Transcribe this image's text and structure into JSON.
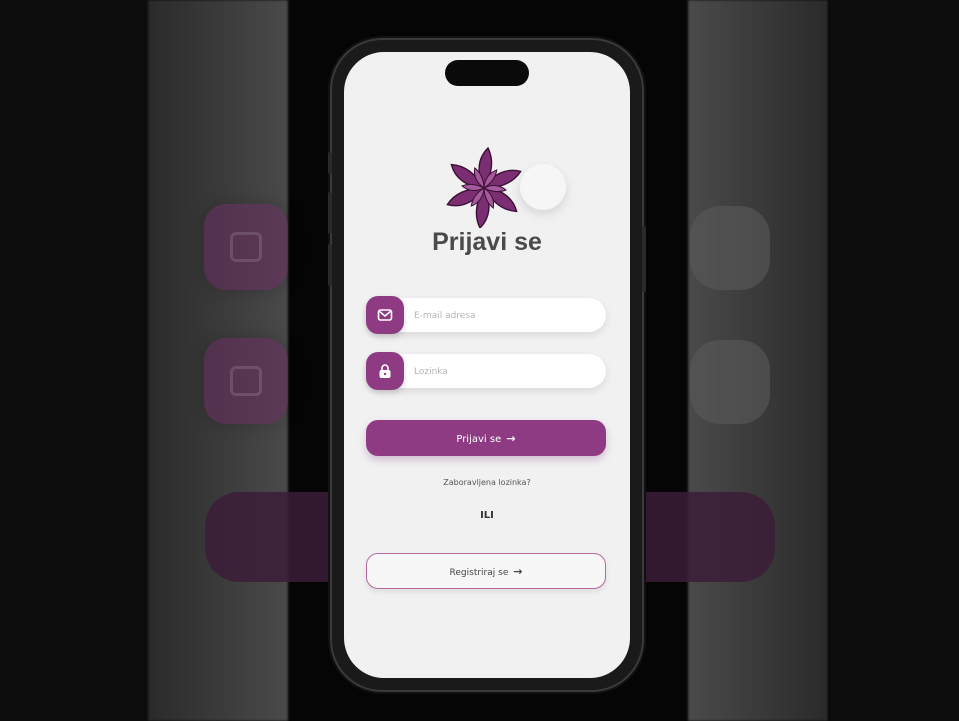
{
  "app": {
    "title": "Prijavi se"
  },
  "fields": {
    "email_placeholder": "E-mail adresa",
    "password_placeholder": "Lozinka"
  },
  "buttons": {
    "login_label": "Prijavi se",
    "register_label": "Registriraj se",
    "arrow": "→"
  },
  "links": {
    "forgot_password": "Zaboravljena lozinka?"
  },
  "divider": {
    "or_text": "ILI"
  },
  "icons": {
    "logo": "star-flower-logo",
    "email": "mail-icon",
    "password": "lock-icon",
    "theme_toggle": "toggle-switch"
  },
  "colors": {
    "accent": "#8e3b84",
    "accent_dark": "#5a2052",
    "screen_bg": "#f1f1f2"
  }
}
